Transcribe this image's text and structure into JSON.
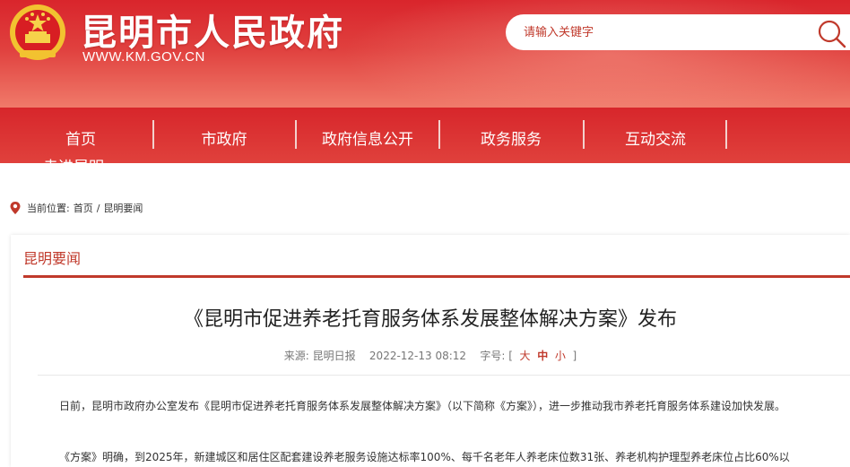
{
  "header": {
    "title": "昆明市人民政府",
    "url": "WWW.KM.GOV.CN",
    "search_placeholder": "请输入关键字"
  },
  "nav": {
    "items": [
      "首页",
      "市政府",
      "政府信息公开",
      "政务服务",
      "互动交流",
      "走进昆明"
    ]
  },
  "breadcrumb": {
    "label": "当前位置:",
    "home": "首页",
    "sep": "/",
    "current": "昆明要闻"
  },
  "section": {
    "title": "昆明要闻"
  },
  "article": {
    "title": "《昆明市促进养老托育服务体系发展整体解决方案》发布",
    "source": "来源: 昆明日报",
    "datetime": "2022-12-13 08:12",
    "fontsize_label": "字号:",
    "fs_open": "[",
    "fs_large": "大",
    "fs_medium": "中",
    "fs_small": "小",
    "fs_close": "]",
    "paragraphs": [
      "日前，昆明市政府办公室发布《昆明市促进养老托育服务体系发展整体解决方案》（以下简称《方案》），进一步推动我市养老托育服务体系建设加快发展。",
      "《方案》明确，到2025年，新建城区和居住区配套建设养老服务设施达标率100%、每千名老年人养老床位数31张、养老机构护理型养老床位占比60%以"
    ]
  },
  "colors": {
    "primary": "#d7262b",
    "accent": "#c0392b"
  }
}
